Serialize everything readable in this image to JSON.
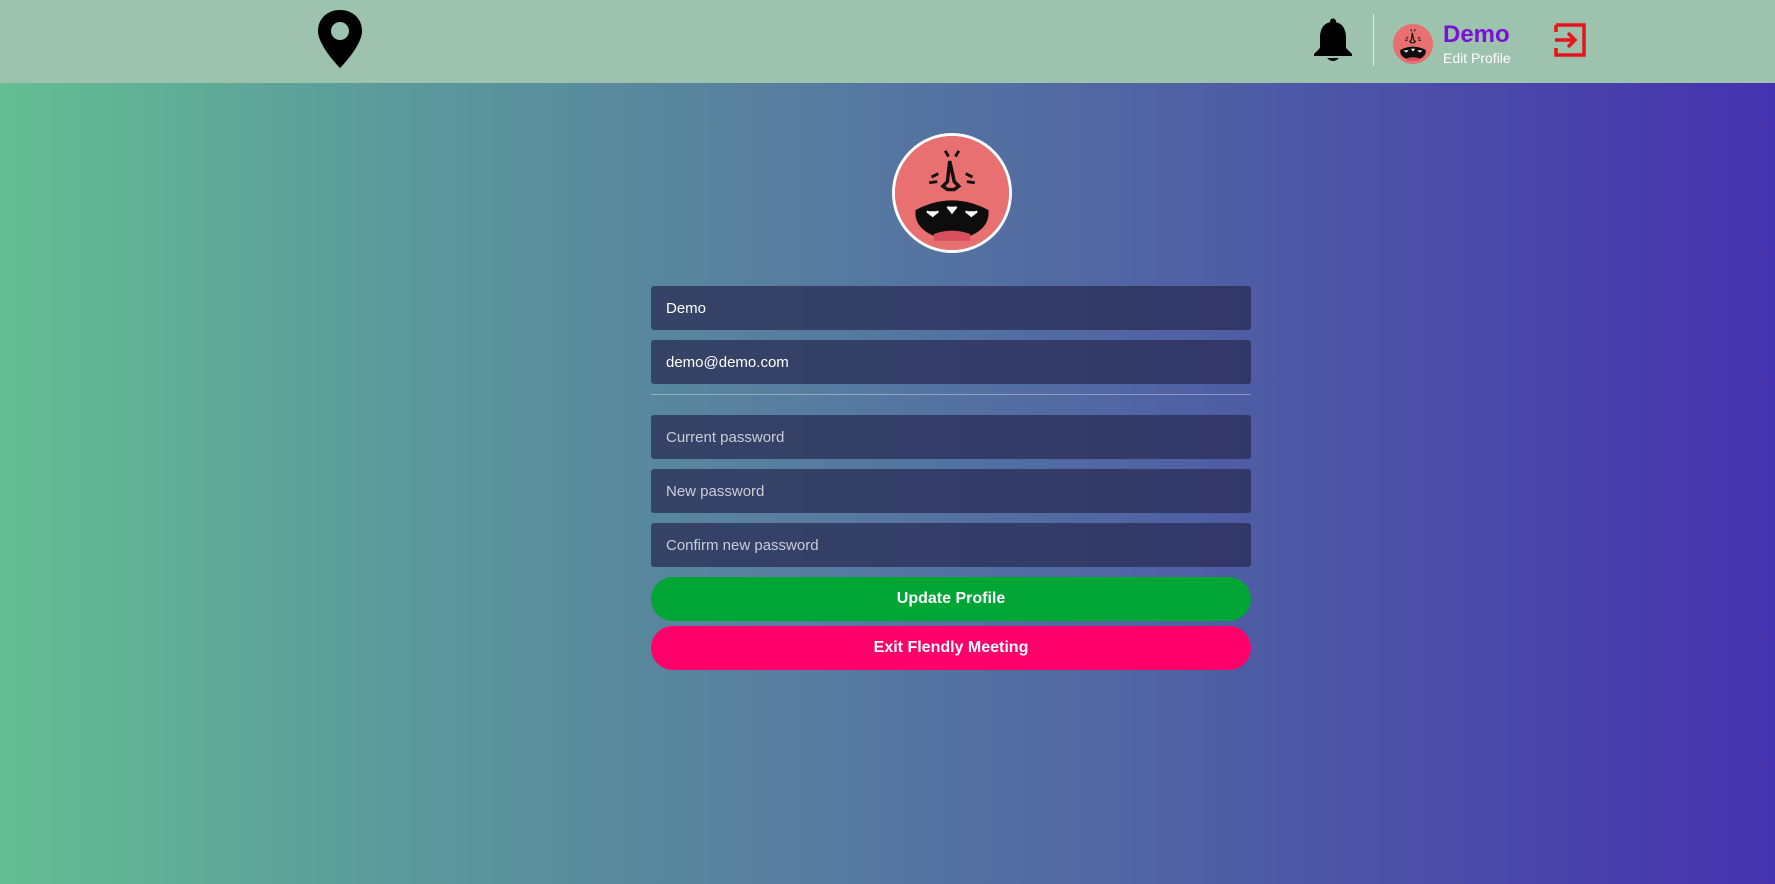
{
  "header": {
    "user_name": "Demo",
    "edit_profile_label": "Edit Profile"
  },
  "icons": {
    "logo": "map-marker-icon",
    "notifications": "bell-icon",
    "logout": "sign-out-icon"
  },
  "colors": {
    "topbar": "#9dc2ae",
    "user_name": "#7a12d4",
    "update_button": "#00a536",
    "exit_button": "#ff006b",
    "logout_icon": "#e8131b",
    "avatar_face": "#e97070"
  },
  "form": {
    "name_value": "Demo",
    "email_value": "demo@demo.com",
    "current_password_placeholder": "Current password",
    "new_password_placeholder": "New password",
    "confirm_password_placeholder": "Confirm new password",
    "update_label": "Update Profile",
    "exit_label": "Exit Flendly Meeting"
  }
}
